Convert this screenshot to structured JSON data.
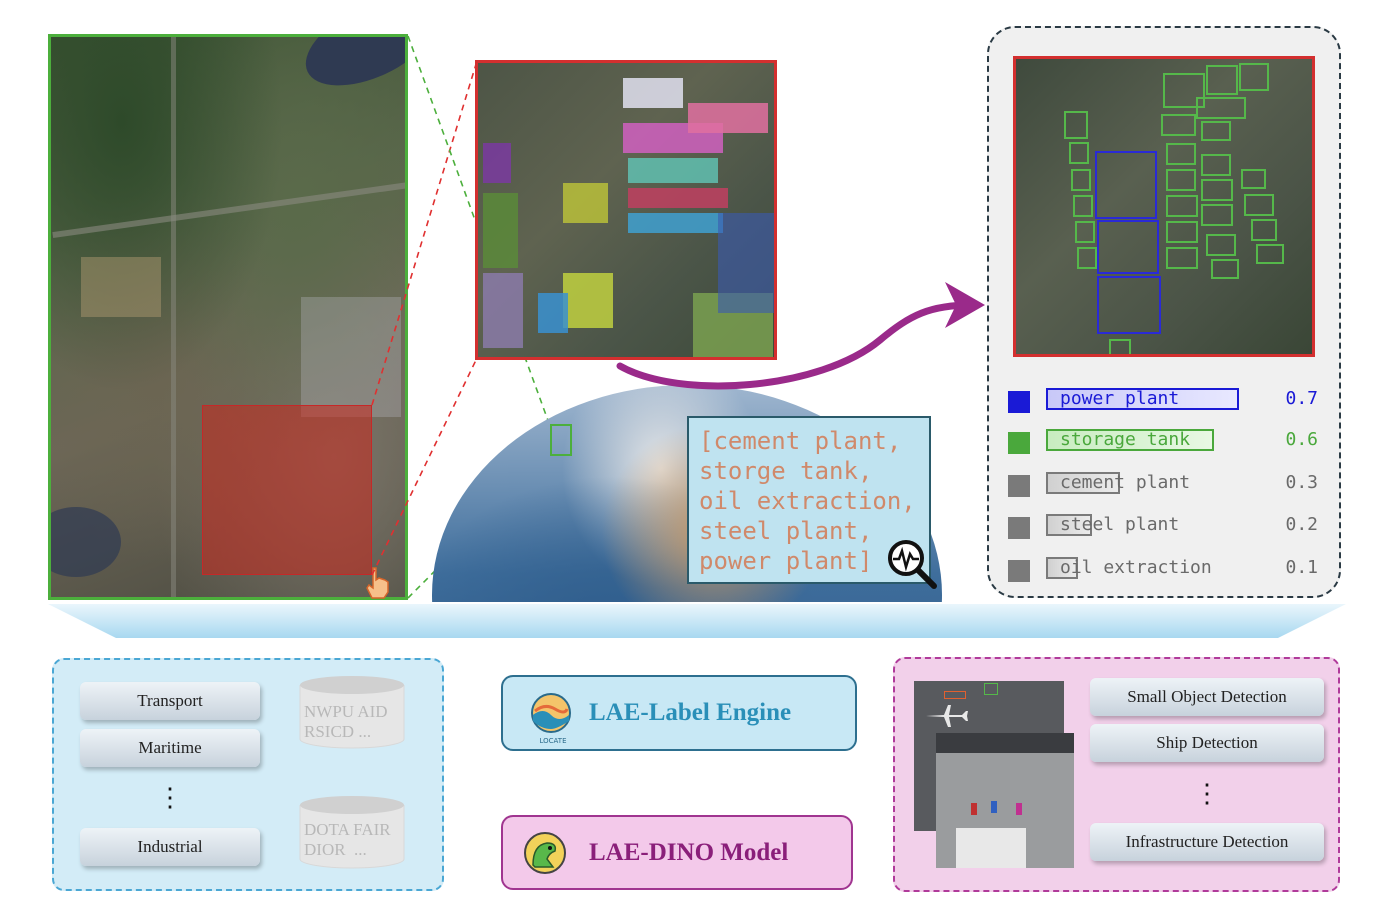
{
  "query": {
    "lines": [
      "[cement plant,",
      "storge tank,",
      "oil extraction,",
      "steel plant,",
      "power plant]"
    ],
    "text_color": "#d0896a",
    "icon": "search-signal-icon"
  },
  "results": [
    {
      "label": "power plant",
      "score": "0.7",
      "color": "#1a1ad6",
      "text_color": "#1a1ad6"
    },
    {
      "label": "storage tank",
      "score": "0.6",
      "color": "#4aa83c",
      "text_color": "#4aa83c"
    },
    {
      "label": "cement plant",
      "score": "0.3",
      "color": "#7a7a7a",
      "text_color": "#6a6a6a"
    },
    {
      "label": "steel plant",
      "score": "0.2",
      "color": "#7a7a7a",
      "text_color": "#6a6a6a"
    },
    {
      "label": "oil extraction",
      "score": "0.1",
      "color": "#7a7a7a",
      "text_color": "#6a6a6a"
    }
  ],
  "categories": {
    "items": [
      "Transport",
      "Maritime",
      "Industrial"
    ],
    "ellipsis": "⋮"
  },
  "datasets": {
    "top": "NWPU AID\nRSICD ...",
    "bottom": "DOTA FAIR\nDIOR  ..."
  },
  "engine": {
    "title": "LAE-Label Engine",
    "logo_text": "LOCATE",
    "color": "#2a8fb8"
  },
  "model": {
    "title": "LAE-DINO Model",
    "color": "#8a1f7a"
  },
  "tasks": {
    "items": [
      "Small Object Detection",
      "Ship Detection",
      "Infrastructure Detection"
    ],
    "ellipsis": "⋮"
  },
  "colors": {
    "green": "#4caf3c",
    "red": "#d32f2f",
    "purple_arrow": "#9a2a8a",
    "band": "#a8d8f0"
  }
}
